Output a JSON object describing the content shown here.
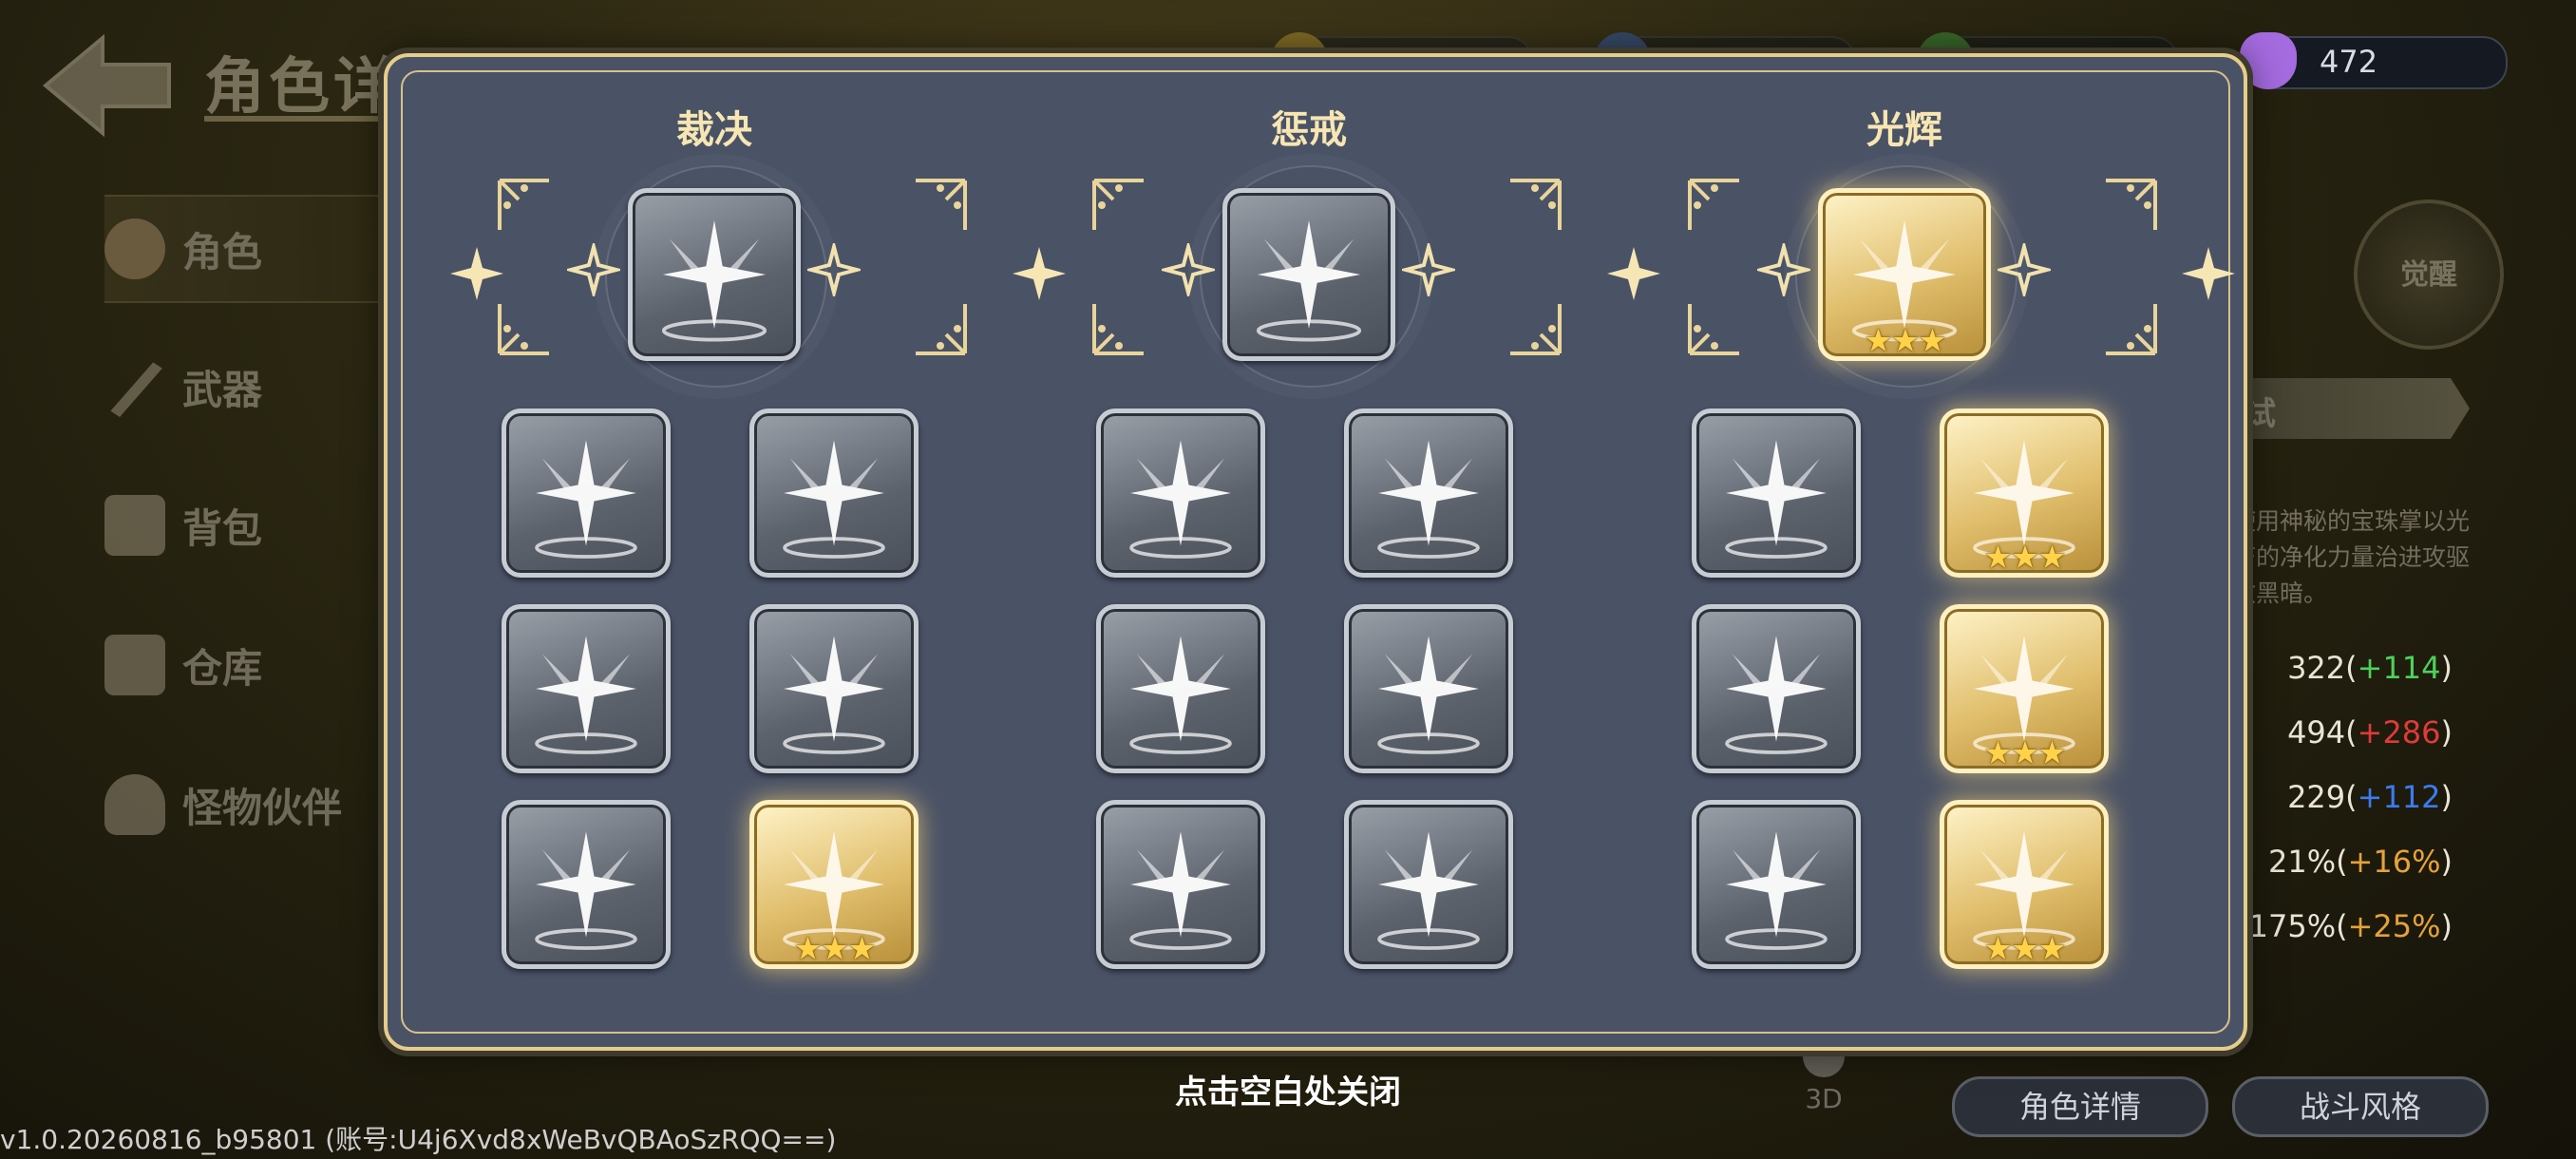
{
  "header": {
    "title": "角色详情"
  },
  "currency": [
    {
      "name": "gold-coin",
      "value": "",
      "color": "#d8b238"
    },
    {
      "name": "blue-gem",
      "value": "",
      "color": "#3b6fd8"
    },
    {
      "name": "green-gem",
      "value": "",
      "color": "#4cbf4a"
    },
    {
      "name": "purple-potion",
      "value": "472",
      "color": "#a56be0"
    }
  ],
  "sidebar": {
    "items": [
      {
        "label": "角色",
        "icon": "character-icon",
        "active": true
      },
      {
        "label": "武器",
        "icon": "weapon-icon",
        "active": false
      },
      {
        "label": "背包",
        "icon": "backpack-icon",
        "active": false
      },
      {
        "label": "仓库",
        "icon": "storage-icon",
        "active": false
      },
      {
        "label": "怪物伙伴",
        "icon": "monster-partner-icon",
        "active": false
      }
    ]
  },
  "right_panel": {
    "awaken_label": "觉醒",
    "tag_text": "试",
    "description": "使用神秘的宝珠掌以光芒的净化力量治进攻驱散黑暗。",
    "stats": [
      {
        "base": "322",
        "bonus": "+114",
        "color": "#4ed15a"
      },
      {
        "base": "494",
        "bonus": "+286",
        "color": "#e03a3a"
      },
      {
        "base": "229",
        "bonus": "+112",
        "color": "#3a7cf0"
      },
      {
        "base": "21%",
        "bonus": "+16%",
        "color": "#e6a23a"
      },
      {
        "base": "175%",
        "bonus": "+25%",
        "color": "#e6a23a"
      }
    ]
  },
  "bottom": {
    "close_hint": "点击空白处关闭",
    "btn_3d": "3D",
    "btn_character_details": "角色详情",
    "btn_battle_style": "战斗风格",
    "version": "v1.0.20260816_b95801 (账号:U4j6Xvd8xWeBvQBAoSzRQQ==)"
  },
  "modal": {
    "columns": [
      {
        "title": "裁决",
        "main": {
          "icon": "radiant-winged-figure-icon",
          "stars": 0,
          "gold": false
        },
        "skills": [
          {
            "icon": "vortex-beam-icon",
            "stars": 0,
            "gold": false
          },
          {
            "icon": "light-impact-icon",
            "stars": 0,
            "gold": false
          },
          {
            "icon": "winged-strike-icon",
            "stars": 0,
            "gold": false
          },
          {
            "icon": "piercing-beams-icon",
            "stars": 0,
            "gold": false
          },
          {
            "icon": "spiral-orb-icon",
            "stars": 0,
            "gold": false
          },
          {
            "icon": "fist-power-up-icon",
            "stars": 3,
            "gold": true
          }
        ]
      },
      {
        "title": "惩戒",
        "main": {
          "icon": "four-point-star-icon",
          "stars": 0,
          "gold": false
        },
        "skills": [
          {
            "icon": "winged-timer-icon",
            "stars": 0,
            "gold": false
          },
          {
            "icon": "rising-sun-icon",
            "stars": 0,
            "gold": false
          },
          {
            "icon": "sun-circle-icon",
            "stars": 0,
            "gold": false
          },
          {
            "icon": "winged-heal-icon",
            "stars": 0,
            "gold": false
          },
          {
            "icon": "winged-swirl-icon",
            "stars": 0,
            "gold": false
          },
          {
            "icon": "crescent-lightning-icon",
            "stars": 0,
            "gold": false
          }
        ]
      },
      {
        "title": "光辉",
        "main": {
          "icon": "haloed-angel-icon",
          "stars": 3,
          "gold": true
        },
        "skills": [
          {
            "icon": "pillar-of-light-icon",
            "stars": 0,
            "gold": false
          },
          {
            "icon": "compass-rune-icon",
            "stars": 3,
            "gold": true
          },
          {
            "icon": "winged-ring-icon",
            "stars": 0,
            "gold": false
          },
          {
            "icon": "halo-angel-burst-icon",
            "stars": 3,
            "gold": true
          },
          {
            "icon": "star-portal-icon",
            "stars": 0,
            "gold": false
          },
          {
            "icon": "lightning-crown-icon",
            "stars": 3,
            "gold": true
          }
        ]
      }
    ]
  }
}
